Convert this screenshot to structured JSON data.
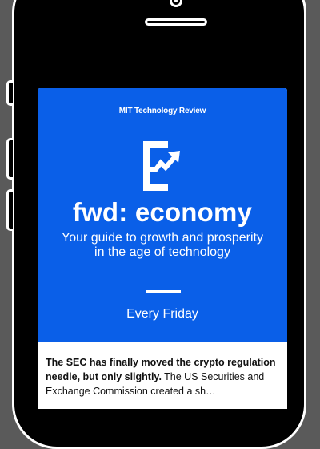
{
  "newsletter": {
    "brand": "MIT Technology Review",
    "title": "fwd: economy",
    "subtitle_line1": "Your guide to growth and prosperity",
    "subtitle_line2": "in the age of technology",
    "frequency": "Every Friday",
    "logo_icon": "e-arrow-logo-icon",
    "accent_color": "#0a5fe8"
  },
  "article": {
    "headline": "The SEC has finally moved the crypto regulation needle, but only slightly.",
    "body": " The US Securities and Exchange Commission created a sh…"
  }
}
